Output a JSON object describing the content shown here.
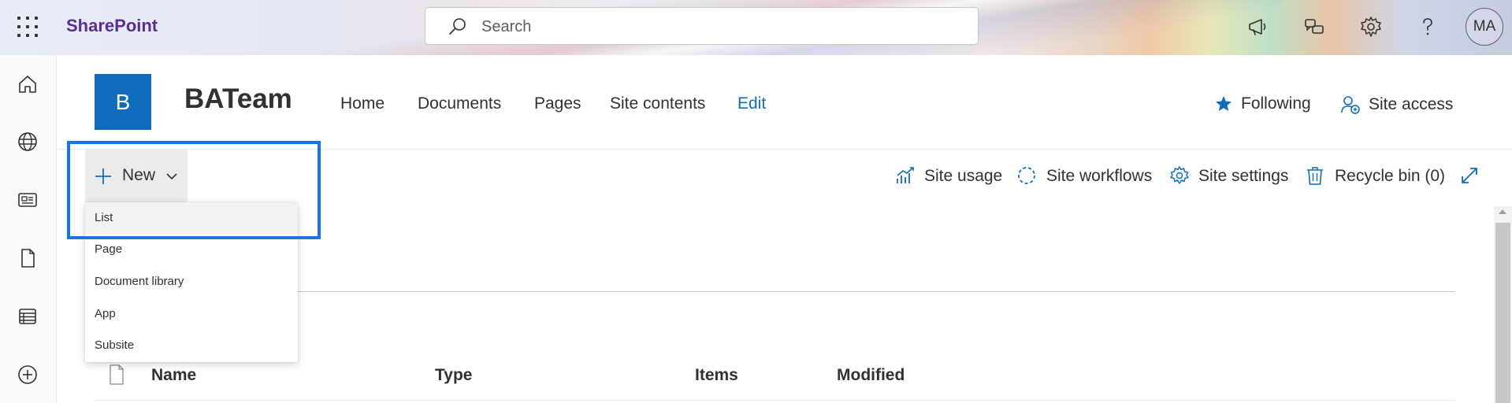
{
  "suite": {
    "brand": "SharePoint",
    "search_placeholder": "Search",
    "avatar_initials": "MA"
  },
  "site": {
    "logo_letter": "B",
    "title": "BATeam",
    "nav": [
      "Home",
      "Documents",
      "Pages",
      "Site contents",
      "Edit"
    ],
    "following_label": "Following",
    "site_access_label": "Site access"
  },
  "commandbar": {
    "new_label": "New",
    "site_usage": "Site usage",
    "site_workflows": "Site workflows",
    "site_settings": "Site settings",
    "recycle_bin": "Recycle bin (0)"
  },
  "new_menu": {
    "items": [
      "List",
      "Page",
      "Document library",
      "App",
      "Subsite"
    ],
    "highlighted": "List"
  },
  "table": {
    "columns": [
      "Name",
      "Type",
      "Items",
      "Modified"
    ]
  },
  "colors": {
    "brand_purple": "#5b2d90",
    "accent_blue": "#0f6cbd",
    "highlight_box": "#1a73e8"
  },
  "icons": [
    "waffle-icon",
    "search-icon",
    "megaphone-icon",
    "feedback-icon",
    "gear-icon",
    "help-icon",
    "home-icon",
    "globe-icon",
    "news-icon",
    "file-icon",
    "list-icon",
    "add-icon",
    "star-icon",
    "people-settings-icon",
    "chart-icon",
    "workflow-icon",
    "settings-icon",
    "trash-icon",
    "expand-icon",
    "plus-icon",
    "chevron-down-icon",
    "document-icon"
  ]
}
